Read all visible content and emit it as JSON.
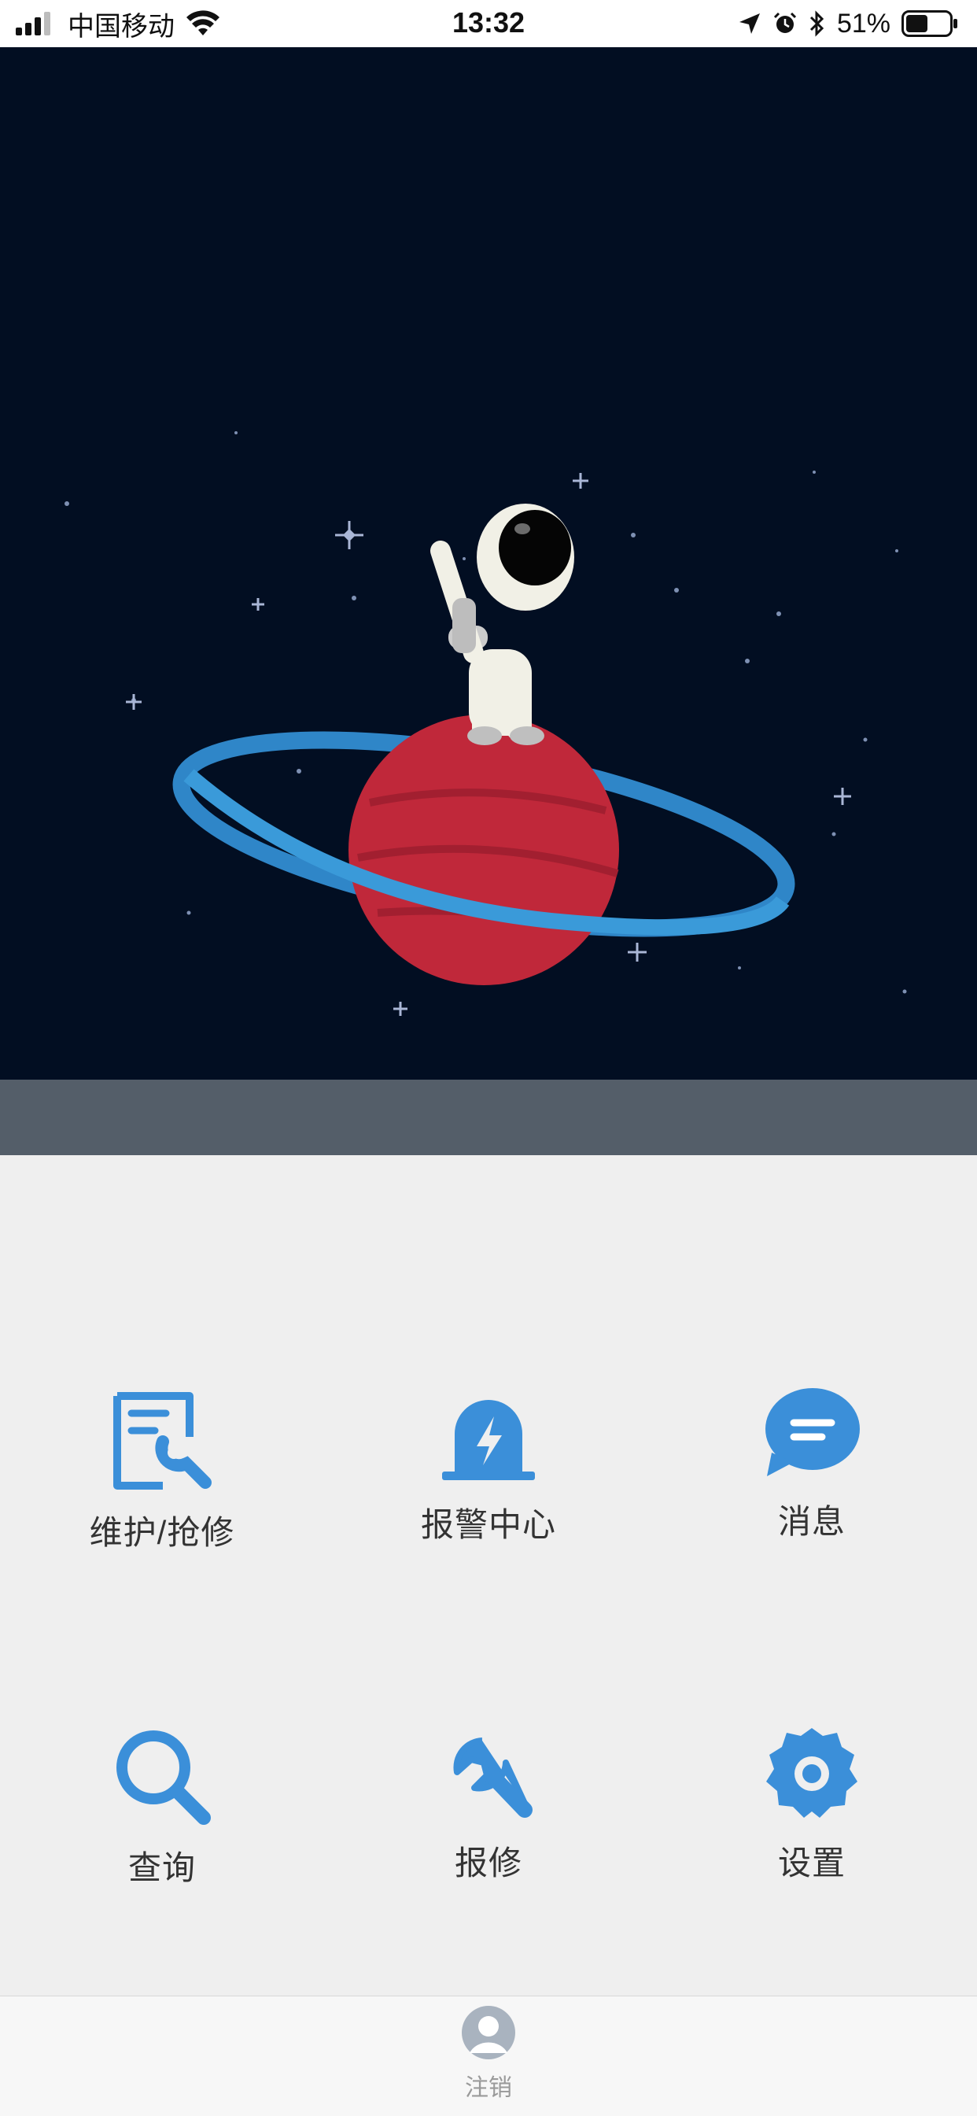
{
  "status_bar": {
    "carrier": "中国移动",
    "time": "13:32",
    "battery_percent": "51%",
    "battery_level": 0.51
  },
  "hero": {
    "icons": [
      "astronaut-illustration",
      "planet-illustration",
      "stars-illustration"
    ]
  },
  "menu": {
    "items": [
      {
        "label": "维护/抢修",
        "icon": "maintenance-icon"
      },
      {
        "label": "报警中心",
        "icon": "alarm-icon"
      },
      {
        "label": "消息",
        "icon": "message-icon"
      },
      {
        "label": "查询",
        "icon": "search-icon"
      },
      {
        "label": "报修",
        "icon": "wrench-icon"
      },
      {
        "label": "设置",
        "icon": "settings-icon"
      }
    ],
    "accent_color": "#3b8fd9"
  },
  "tabbar": {
    "logout_label": "注销",
    "icon": "user-avatar-icon"
  }
}
